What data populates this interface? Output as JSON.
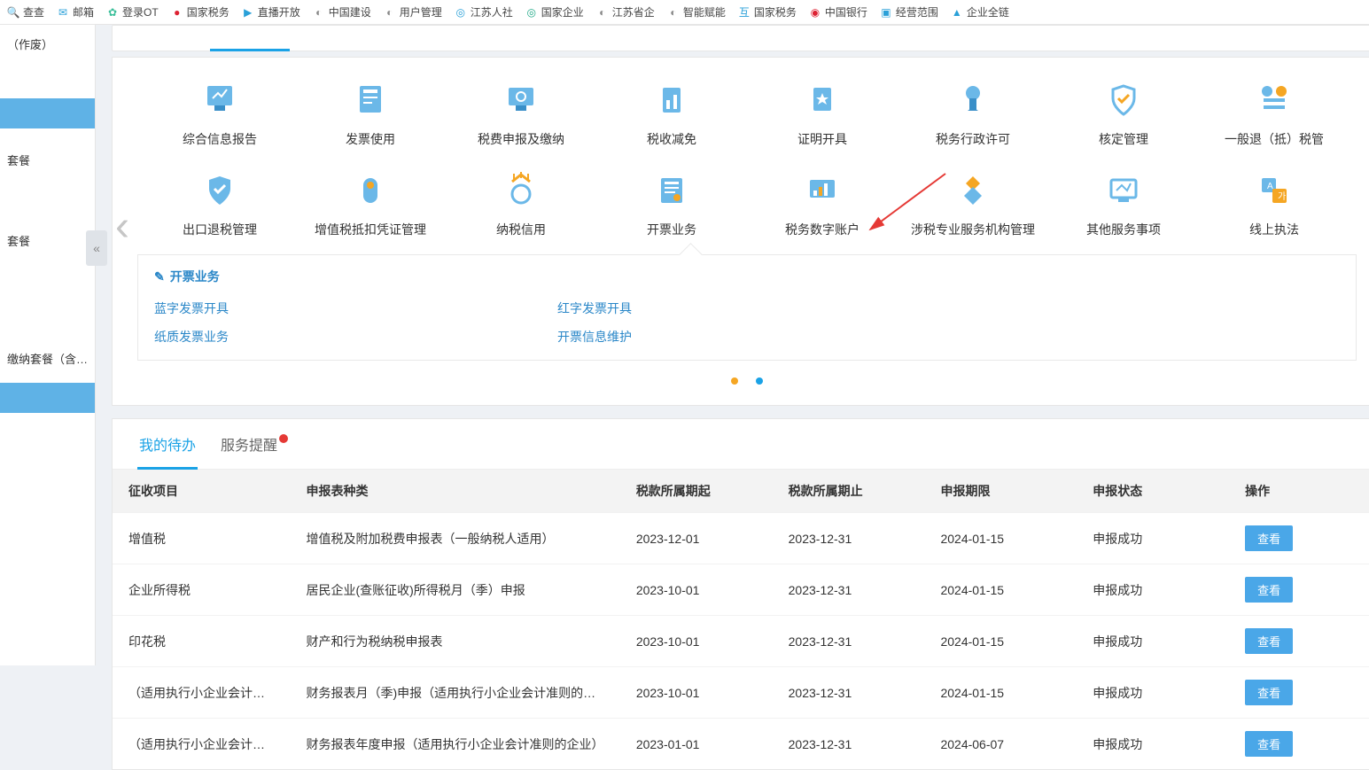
{
  "bookmarks": [
    {
      "label": "查查",
      "fav": "🔍",
      "color": "#2aa0d8"
    },
    {
      "label": "邮箱",
      "fav": "✉",
      "color": "#2aa0d8"
    },
    {
      "label": "登录OT",
      "fav": "✿",
      "color": "#3bbf9a"
    },
    {
      "label": "国家税务",
      "fav": "●",
      "color": "#d23"
    },
    {
      "label": "直播开放",
      "fav": "▶",
      "color": "#2aa0d8"
    },
    {
      "label": "中国建设",
      "fav": "◐",
      "color": "#888"
    },
    {
      "label": "用户管理",
      "fav": "◐",
      "color": "#888"
    },
    {
      "label": "江苏人社",
      "fav": "◎",
      "color": "#2aa0d8"
    },
    {
      "label": "国家企业",
      "fav": "◎",
      "color": "#2a8"
    },
    {
      "label": "江苏省企",
      "fav": "◐",
      "color": "#888"
    },
    {
      "label": "智能赋能",
      "fav": "◐",
      "color": "#888"
    },
    {
      "label": "国家税务",
      "fav": "互",
      "color": "#2aa0d8"
    },
    {
      "label": "中国银行",
      "fav": "◉",
      "color": "#d23"
    },
    {
      "label": "经营范围",
      "fav": "▣",
      "color": "#2aa0d8"
    },
    {
      "label": "企业全链",
      "fav": "▲",
      "color": "#2aa0d8"
    }
  ],
  "sidebar": {
    "items": [
      {
        "label": "（作废）"
      },
      {
        "label": ""
      },
      {
        "label": "套餐"
      },
      {
        "label": "套餐"
      },
      {
        "label": "缴纳套餐（含…"
      }
    ]
  },
  "services": {
    "row1": [
      {
        "label": "综合信息报告",
        "icon": "report"
      },
      {
        "label": "发票使用",
        "icon": "invoice-use"
      },
      {
        "label": "税费申报及缴纳",
        "icon": "declare"
      },
      {
        "label": "税收减免",
        "icon": "reduce"
      },
      {
        "label": "证明开具",
        "icon": "cert"
      },
      {
        "label": "税务行政许可",
        "icon": "permit"
      },
      {
        "label": "核定管理",
        "icon": "shield"
      },
      {
        "label": "一般退（抵）税管",
        "icon": "refund"
      }
    ],
    "row2": [
      {
        "label": "出口退税管理",
        "icon": "export"
      },
      {
        "label": "增值税抵扣凭证管理",
        "icon": "vat"
      },
      {
        "label": "纳税信用",
        "icon": "credit"
      },
      {
        "label": "开票业务",
        "icon": "invoice"
      },
      {
        "label": "税务数字账户",
        "icon": "digital"
      },
      {
        "label": "涉税专业服务机构管理",
        "icon": "pro"
      },
      {
        "label": "其他服务事项",
        "icon": "other"
      },
      {
        "label": "线上执法",
        "icon": "law"
      }
    ]
  },
  "sub_panel": {
    "title": "开票业务",
    "links": [
      "蓝字发票开具",
      "红字发票开具",
      "纸质发票业务",
      "开票信息维护"
    ]
  },
  "todo": {
    "tabs": [
      "我的待办",
      "服务提醒"
    ],
    "headers": [
      "征收项目",
      "申报表种类",
      "税款所属期起",
      "税款所属期止",
      "申报期限",
      "申报状态",
      "操作"
    ],
    "rows": [
      {
        "a": "增值税",
        "b": "增值税及附加税费申报表（一般纳税人适用）",
        "c": "2023-12-01",
        "d": "2023-12-31",
        "e": "2024-01-15",
        "f": "申报成功"
      },
      {
        "a": "企业所得税",
        "b": "居民企业(查账征收)所得税月（季）申报",
        "c": "2023-10-01",
        "d": "2023-12-31",
        "e": "2024-01-15",
        "f": "申报成功"
      },
      {
        "a": "印花税",
        "b": "财产和行为税纳税申报表",
        "c": "2023-10-01",
        "d": "2023-12-31",
        "e": "2024-01-15",
        "f": "申报成功"
      },
      {
        "a": "（适用执行小企业会计准则…",
        "b": "财务报表月（季)申报（适用执行小企业会计准则的企业）",
        "c": "2023-10-01",
        "d": "2023-12-31",
        "e": "2024-01-15",
        "f": "申报成功"
      },
      {
        "a": "（适用执行小企业会计准则…",
        "b": "财务报表年度申报（适用执行小企业会计准则的企业）",
        "c": "2023-01-01",
        "d": "2023-12-31",
        "e": "2024-06-07",
        "f": "申报成功"
      }
    ],
    "view_label": "查看"
  }
}
